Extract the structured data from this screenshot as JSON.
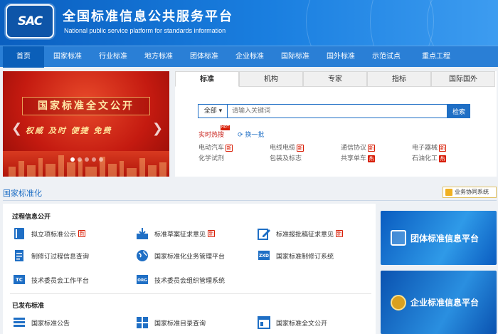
{
  "header": {
    "logo_text": "SAC",
    "title_cn": "全国标准信息公共服务平台",
    "title_en": "National public service platform  for standards information"
  },
  "nav": {
    "items": [
      "首页",
      "国家标准",
      "行业标准",
      "地方标准",
      "团体标准",
      "企业标准",
      "国际标准",
      "国外标准",
      "示范试点",
      "重点工程"
    ],
    "active_index": 0
  },
  "banner": {
    "title": "国家标准全文公开",
    "subtitle": "权威  及时  便捷  免费",
    "slide_count": 5,
    "active_slide": 0
  },
  "search": {
    "tabs": [
      "标准",
      "机构",
      "专家",
      "指标",
      "国际国外"
    ],
    "active_tab": 0,
    "scope": "全部",
    "placeholder": "请输入关键词",
    "button": "检索",
    "hot_label": "实时热搜",
    "hot_badge": "HOT",
    "refresh_label": "换一批",
    "hot_keywords": [
      {
        "text": "电动汽车",
        "tag": "新"
      },
      {
        "text": "电线电缆",
        "tag": "新"
      },
      {
        "text": "通信协议",
        "tag": "新"
      },
      {
        "text": "电子器械",
        "tag": "新"
      },
      {
        "text": "化学试剂",
        "tag": ""
      },
      {
        "text": "包装及标志",
        "tag": ""
      },
      {
        "text": "共享单车",
        "tag": "热"
      },
      {
        "text": "石油化工",
        "tag": "热"
      }
    ]
  },
  "section": {
    "title": "国家标准化",
    "collab_button": "业务协同系统"
  },
  "groups": [
    {
      "title": "过程信息公开",
      "items": [
        {
          "label": "拟立项标准公示",
          "icon": "book-icon",
          "tag": "new"
        },
        {
          "label": "标准草案征求意见",
          "icon": "download-icon",
          "tag": "new"
        },
        {
          "label": "标准报批稿征求意见",
          "icon": "edit-icon",
          "tag": "new"
        },
        {
          "label": "制修订过程信息查询",
          "icon": "document-icon",
          "tag": ""
        },
        {
          "label": "国家标准化业务管理平台",
          "icon": "globe-icon",
          "tag": ""
        },
        {
          "label": "国家标准制修订系统",
          "icon": "zxd-icon",
          "tag": ""
        },
        {
          "label": "技术委员会工作平台",
          "icon": "tc-icon",
          "tag": ""
        },
        {
          "label": "技术委员会组织管理系统",
          "icon": "org-icon",
          "tag": ""
        }
      ]
    },
    {
      "title": "已发布标准",
      "items": [
        {
          "label": "国家标准公告",
          "icon": "list-icon",
          "tag": ""
        },
        {
          "label": "国家标准目录查询",
          "icon": "grid-icon",
          "tag": ""
        },
        {
          "label": "国家标准全文公开",
          "icon": "window-icon",
          "tag": ""
        }
      ]
    }
  ],
  "tag_labels": {
    "new": "新"
  },
  "promos": [
    "团体标准信息平台",
    "企业标准信息平台"
  ],
  "colors": {
    "brand": "#1f6fc5",
    "nav": "#2a7fd6",
    "nav_active": "#0b5fb9",
    "hot": "#d81e06"
  }
}
